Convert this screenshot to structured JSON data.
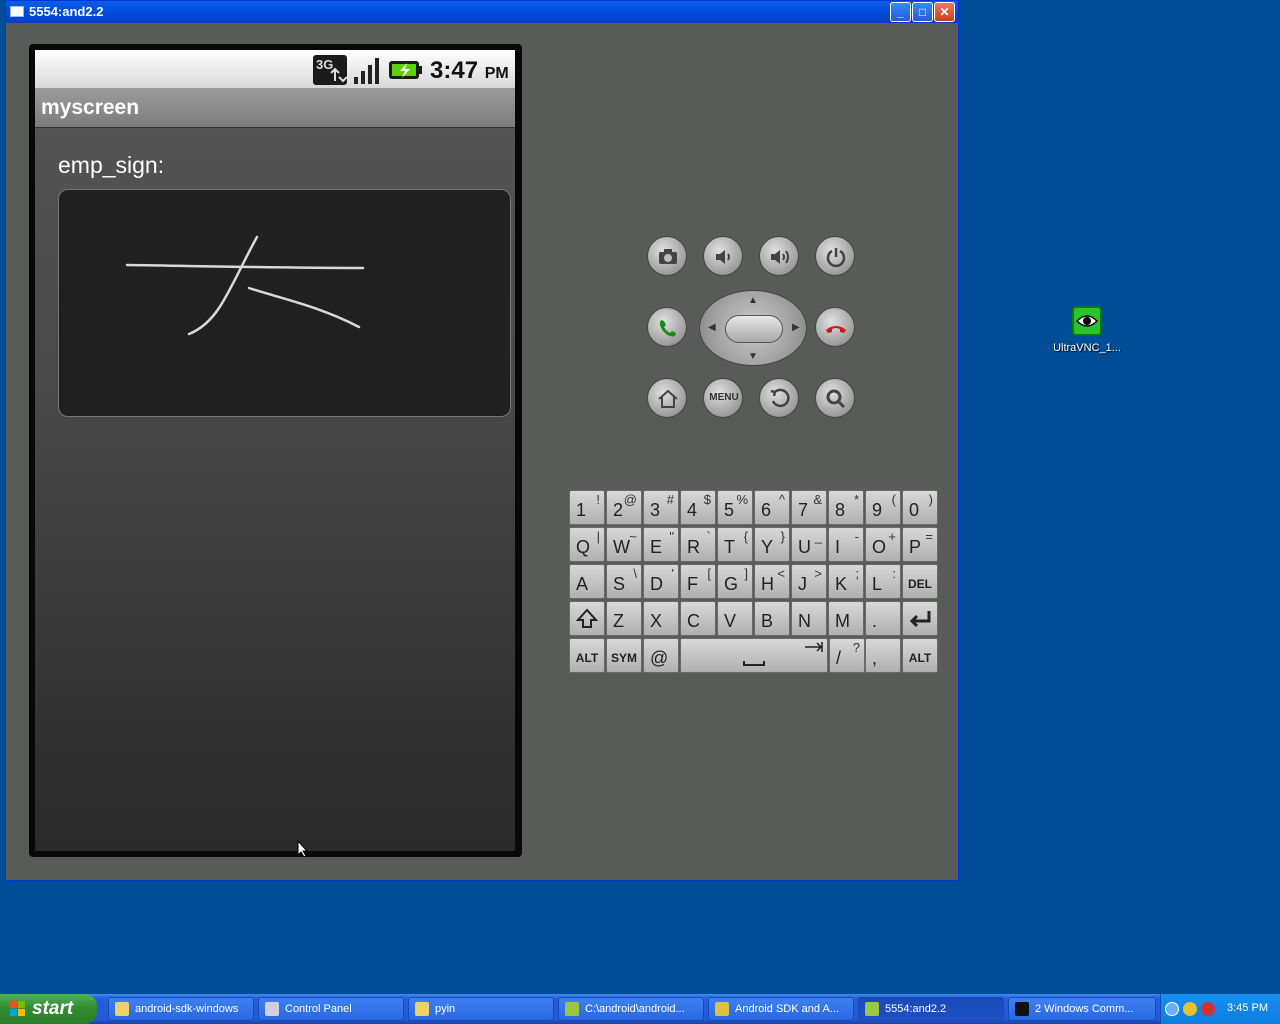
{
  "window": {
    "title": "5554:and2.2",
    "minimize_glyph": "_",
    "maximize_glyph": "□",
    "close_glyph": "✕"
  },
  "phone": {
    "status_bar": {
      "network_label": "3G",
      "clock_time": "3:47",
      "clock_ampm": "PM"
    },
    "app_title": "myscreen",
    "signature_label": "emp_sign:"
  },
  "controls": {
    "menu_label": "MENU"
  },
  "keyboard": {
    "rows": [
      [
        {
          "k": "1",
          "a": "!"
        },
        {
          "k": "2",
          "a": "@"
        },
        {
          "k": "3",
          "a": "#"
        },
        {
          "k": "4",
          "a": "$"
        },
        {
          "k": "5",
          "a": "%"
        },
        {
          "k": "6",
          "a": "^"
        },
        {
          "k": "7",
          "a": "&"
        },
        {
          "k": "8",
          "a": "*"
        },
        {
          "k": "9",
          "a": "("
        },
        {
          "k": "0",
          "a": ")"
        }
      ],
      [
        {
          "k": "Q",
          "a": "|"
        },
        {
          "k": "W",
          "a": "~"
        },
        {
          "k": "E",
          "a": "\""
        },
        {
          "k": "R",
          "a": "`"
        },
        {
          "k": "T",
          "a": "{"
        },
        {
          "k": "Y",
          "a": "}"
        },
        {
          "k": "U",
          "a": "_"
        },
        {
          "k": "I",
          "a": "-"
        },
        {
          "k": "O",
          "a": "+"
        },
        {
          "k": "P",
          "a": "="
        }
      ],
      [
        {
          "k": "A",
          "a": ""
        },
        {
          "k": "S",
          "a": "\\"
        },
        {
          "k": "D",
          "a": "'"
        },
        {
          "k": "F",
          "a": "["
        },
        {
          "k": "G",
          "a": "]"
        },
        {
          "k": "H",
          "a": "<"
        },
        {
          "k": "J",
          "a": ">"
        },
        {
          "k": "K",
          "a": ";"
        },
        {
          "k": "L",
          "a": ":"
        }
      ],
      [
        {
          "k": "Z",
          "a": ""
        },
        {
          "k": "X",
          "a": ""
        },
        {
          "k": "C",
          "a": ""
        },
        {
          "k": "V",
          "a": ""
        },
        {
          "k": "B",
          "a": ""
        },
        {
          "k": "N",
          "a": ""
        },
        {
          "k": "M",
          "a": ""
        },
        {
          "k": ".",
          "a": ""
        }
      ]
    ],
    "del_label": "DEL",
    "alt_label": "ALT",
    "sym_label": "SYM",
    "at_label": "@",
    "slash_key": "/",
    "slash_alt": "?",
    "comma_key": ","
  },
  "desktop_icon": {
    "label": "UltraVNC_1..."
  },
  "taskbar": {
    "start_label": "start",
    "items": [
      {
        "label": "android-sdk-windows",
        "icon": "folder-icon"
      },
      {
        "label": "Control Panel",
        "icon": "control-panel-icon"
      },
      {
        "label": "pyin",
        "icon": "folder-icon"
      },
      {
        "label": "C:\\android\\android...",
        "icon": "android-icon"
      },
      {
        "label": "Android SDK and A...",
        "icon": "download-icon"
      },
      {
        "label": "5554:and2.2",
        "icon": "android-icon",
        "active": true
      },
      {
        "label": "2 Windows Comm...",
        "icon": "cmd-icon"
      }
    ],
    "tray_time": "3:45 PM"
  }
}
